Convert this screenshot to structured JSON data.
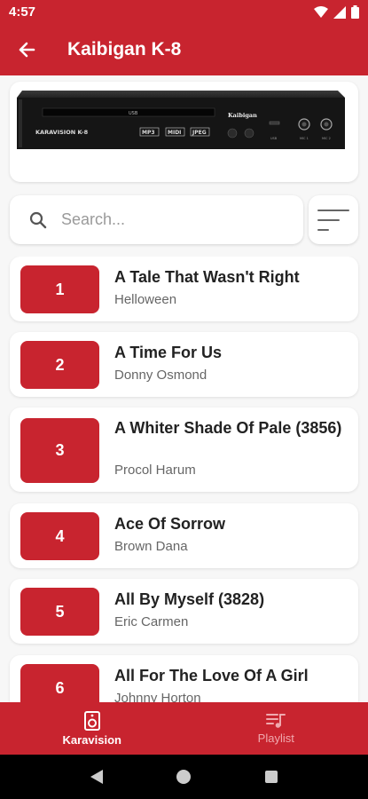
{
  "status": {
    "time": "4:57"
  },
  "app_bar": {
    "title": "Kaibigan K-8"
  },
  "device": {
    "brand": "KARAVISION K-8",
    "top_brand": "Kaibigan",
    "formats": [
      "MP3",
      "MIDI",
      "JPEG"
    ]
  },
  "search": {
    "placeholder": "Search..."
  },
  "songs": [
    {
      "number": "1",
      "title": "A Tale That Wasn't Right",
      "artist": "Helloween"
    },
    {
      "number": "2",
      "title": "A Time For Us",
      "artist": "Donny Osmond"
    },
    {
      "number": "3",
      "title": "A Whiter Shade Of Pale (3856)",
      "artist": "Procol Harum"
    },
    {
      "number": "4",
      "title": "Ace Of Sorrow",
      "artist": "Brown Dana"
    },
    {
      "number": "5",
      "title": "All By Myself (3828)",
      "artist": "Eric Carmen"
    },
    {
      "number": "6",
      "title": "All For The Love Of A Girl",
      "artist": "Johnny Horton"
    }
  ],
  "bottom_nav": {
    "karavision_label": "Karavision",
    "playlist_label": "Playlist"
  },
  "colors": {
    "accent": "#c8242f"
  }
}
